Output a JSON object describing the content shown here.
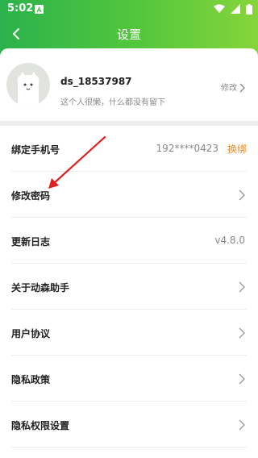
{
  "status_bar": {
    "time": "5:02",
    "notification_icon": "notification-a-icon",
    "icons": [
      "wifi-icon",
      "signal-icon",
      "battery-icon"
    ]
  },
  "header": {
    "title": "设置",
    "back_icon": "back-arrow-icon",
    "gradient_colors": [
      "#2bb24c",
      "#86d53a"
    ]
  },
  "profile": {
    "username": "ds_18537987",
    "signature": "这个人很懒，什么都没有留下",
    "edit_label": "修改"
  },
  "settings": {
    "phone": {
      "label": "绑定手机号",
      "value": "192****0423",
      "action": "换绑",
      "action_color": "#f0892a"
    },
    "password": {
      "label": "修改密码"
    },
    "changelog": {
      "label": "更新日志",
      "value": "v4.8.0"
    },
    "about": {
      "label": "关于动森助手"
    },
    "agreement": {
      "label": "用户协议"
    },
    "privacy": {
      "label": "隐私政策"
    },
    "permissions": {
      "label": "隐私权限设置"
    }
  },
  "annotation": {
    "arrow_color": "#e02020"
  }
}
